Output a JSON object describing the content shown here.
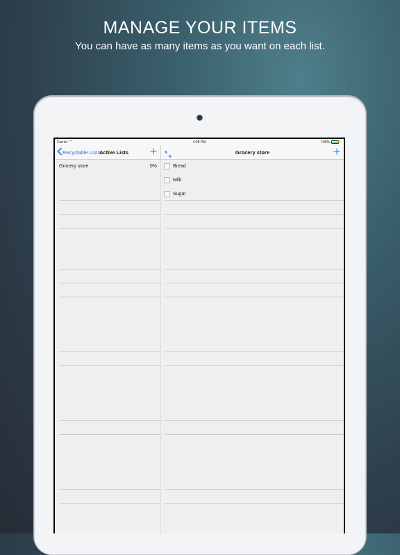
{
  "promo": {
    "headline": "MANAGE YOUR ITEMS",
    "subline": "You can have as many items as you want on each list."
  },
  "status_bar": {
    "carrier": "Carrier",
    "time": "4:28 PM",
    "battery": "100%"
  },
  "master": {
    "back_label": "Recyclable Lists",
    "title": "Active Lists",
    "add_icon": "plus-icon",
    "lists": [
      {
        "name": "Grocery store",
        "progress": "0%"
      }
    ]
  },
  "detail": {
    "expand_icon": "expand-arrows-icon",
    "title": "Grocery store",
    "add_icon": "plus-icon",
    "items": [
      {
        "name": "Bread",
        "checked": false
      },
      {
        "name": "Milk",
        "checked": false
      },
      {
        "name": "Sugar",
        "checked": false
      }
    ]
  },
  "colors": {
    "accent": "#1a7cf5",
    "ipad_frame": "#f3f4f6",
    "list_background": "#efefef"
  }
}
